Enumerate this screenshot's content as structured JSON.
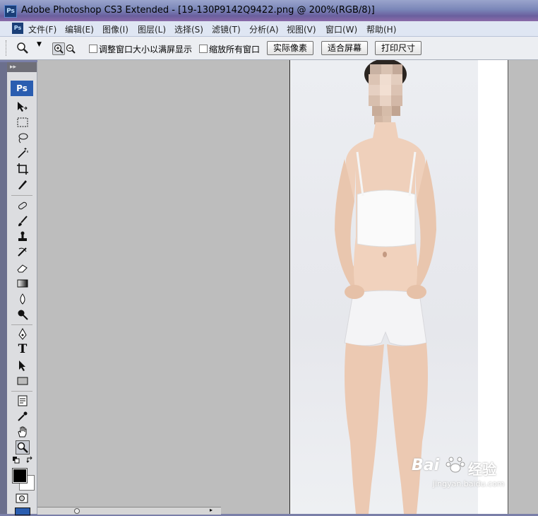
{
  "window": {
    "title": "Adobe Photoshop CS3 Extended - [19-130P9142Q9422.png @ 200%(RGB/8)]",
    "app_icon_text": "Ps"
  },
  "menubar": {
    "items": [
      {
        "label": "文件(F)"
      },
      {
        "label": "编辑(E)"
      },
      {
        "label": "图像(I)"
      },
      {
        "label": "图层(L)"
      },
      {
        "label": "选择(S)"
      },
      {
        "label": "滤镜(T)"
      },
      {
        "label": "分析(A)"
      },
      {
        "label": "视图(V)"
      },
      {
        "label": "窗口(W)"
      },
      {
        "label": "帮助(H)"
      }
    ]
  },
  "options": {
    "resize_windows_label": "调整窗口大小以满屏显示",
    "zoom_all_windows_label": "缩放所有窗口",
    "actual_pixels_label": "实际像素",
    "fit_screen_label": "适合屏幕",
    "print_size_label": "打印尺寸",
    "resize_windows_checked": false,
    "zoom_all_windows_checked": false
  },
  "toolbox": {
    "badge": "Ps",
    "tools": [
      "move-tool-icon",
      "marquee-tool-icon",
      "lasso-tool-icon",
      "magic-wand-tool-icon",
      "crop-tool-icon",
      "slice-tool-icon",
      "healing-brush-tool-icon",
      "brush-tool-icon",
      "clone-stamp-tool-icon",
      "history-brush-tool-icon",
      "eraser-tool-icon",
      "gradient-tool-icon",
      "blur-tool-icon",
      "dodge-tool-icon",
      "pen-tool-icon",
      "type-tool-icon",
      "path-selection-tool-icon",
      "rectangle-tool-icon",
      "notes-tool-icon",
      "eyedropper-tool-icon",
      "hand-tool-icon",
      "zoom-tool-icon"
    ],
    "type_tool_glyph": "T",
    "foreground_color": "#000000",
    "background_color": "#ffffff"
  },
  "watermark": {
    "brand": "Bai",
    "brand_cn": "经验",
    "sub": "jingyan.baidu.com"
  },
  "colors": {
    "title_gradient": "#7a86b8",
    "menubar_bg": "#dfe6f3",
    "workarea_bg": "#bdbdbd",
    "toolbox_bg": "#dcdde0",
    "ps_blue": "#2a5db0"
  }
}
